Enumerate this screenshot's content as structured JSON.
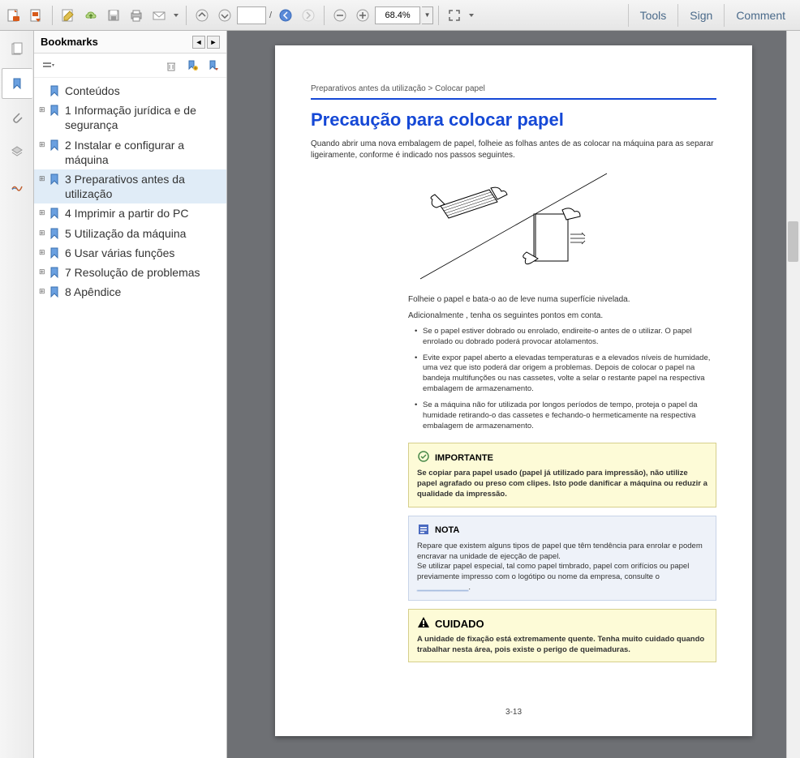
{
  "toolbar": {
    "page_current": "",
    "page_total": "/ ",
    "zoom": "68.4%",
    "tools": "Tools",
    "sign": "Sign",
    "comment": "Comment"
  },
  "bookmarks_panel": {
    "title": "Bookmarks",
    "items": [
      {
        "label": "Conteúdos",
        "expandable": false
      },
      {
        "label": "1 Informação jurídica e de segurança",
        "expandable": true
      },
      {
        "label": "2 Instalar e configurar a máquina",
        "expandable": true
      },
      {
        "label": "3 Preparativos antes da utilização",
        "expandable": true,
        "selected": true
      },
      {
        "label": "4 Imprimir a partir do PC",
        "expandable": true
      },
      {
        "label": "5 Utilização da máquina",
        "expandable": true
      },
      {
        "label": "6 Usar várias funções",
        "expandable": true
      },
      {
        "label": "7 Resolução de problemas",
        "expandable": true
      },
      {
        "label": "8 Apêndice",
        "expandable": true
      }
    ]
  },
  "doc": {
    "breadcrumb": "Preparativos antes da utilização > Colocar papel",
    "title": "Precaução para colocar papel",
    "intro": "Quando abrir uma nova embalagem de papel, folheie as folhas antes de as colocar na máquina para as separar ligeiramente, conforme é indicado nos passos seguintes.",
    "line1": "Folheie o papel e bata-o ao de leve numa superfície nivelada.",
    "line2": "Adicionalmente , tenha os seguintes pontos em conta.",
    "bullets": [
      "Se o papel estiver dobrado ou enrolado, endireite-o antes de o utilizar. O papel enrolado ou dobrado poderá provocar atolamentos.",
      "Evite expor papel aberto a elevadas temperaturas e a elevados níveis de humidade, uma vez que isto poderá dar origem a problemas. Depois de colocar o papel na bandeja multifunções ou nas cassetes, volte a selar o restante papel na respectiva embalagem de armazenamento.",
      "Se a máquina não for utilizada por longos períodos de tempo, proteja o papel da humidade retirando-o das cassetes e fechando-o hermeticamente na respectiva embalagem de armazenamento."
    ],
    "importante_title": "IMPORTANTE",
    "importante_body": "Se copiar para papel usado (papel já utilizado para impressão), não utilize papel agrafado ou preso com clipes. Isto pode danificar a máquina ou reduzir a qualidade da impressão.",
    "nota_title": "NOTA",
    "nota_body1": "Repare que existem alguns tipos de papel que têm tendência para enrolar e podem encravar na unidade de ejecção de papel.",
    "nota_body2a": "Se utilizar papel especial, tal como papel timbrado, papel com orifícios ou papel previamente impresso com o logótipo ou nome da empresa, consulte o ",
    "nota_link": "____________",
    "cuidado_title": "CUIDADO",
    "cuidado_body": "A unidade de fixação está extremamente quente. Tenha muito cuidado quando trabalhar nesta área, pois existe o perigo de queimaduras.",
    "page_num": "3-13"
  }
}
